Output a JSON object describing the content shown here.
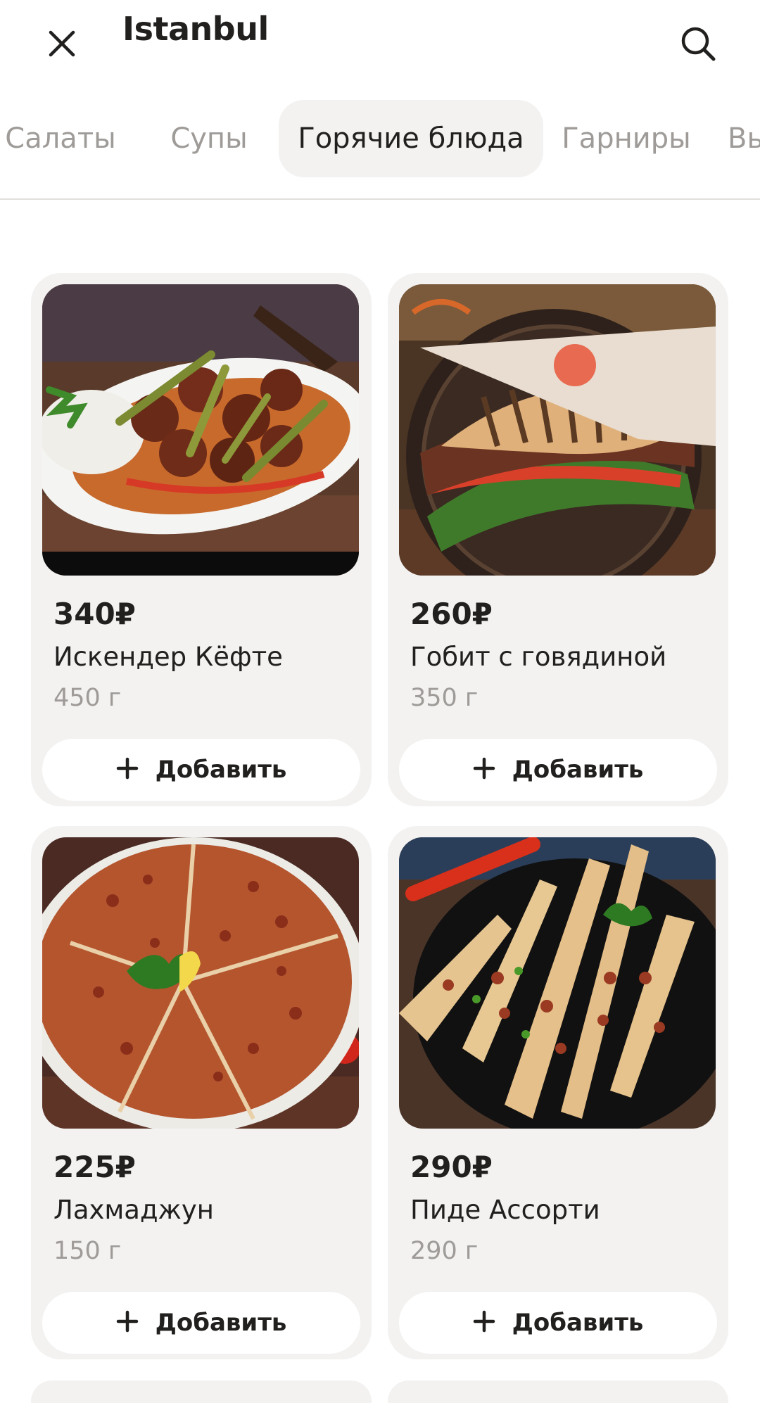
{
  "header": {
    "title": "Istanbul",
    "close_icon": "close-icon",
    "search_icon": "search-icon"
  },
  "tabs": [
    {
      "label": "Салаты",
      "active": false
    },
    {
      "label": "Супы",
      "active": false
    },
    {
      "label": "Горячие блюда",
      "active": true
    },
    {
      "label": "Гарниры",
      "active": false
    },
    {
      "label": "Вы",
      "active": false
    }
  ],
  "add_label": "Добавить",
  "products": [
    {
      "price": "340₽",
      "name": "Искендер Кёфте",
      "weight": "450 г",
      "image": "meatballs-with-rice-dish"
    },
    {
      "price": "260₽",
      "name": "Гобит с говядиной",
      "weight": "350 г",
      "image": "beef-pita-sandwich"
    },
    {
      "price": "225₽",
      "name": "Лахмаджун",
      "weight": "150 г",
      "image": "lahmacun-flatbread"
    },
    {
      "price": "290₽",
      "name": "Пиде Ассорти",
      "weight": "290 г",
      "image": "assorted-pide-slices"
    }
  ],
  "colors": {
    "accent_text": "#21201f",
    "muted_text": "#9e9b98",
    "card_bg": "#f3f2f1",
    "button_bg": "#ffffff"
  }
}
